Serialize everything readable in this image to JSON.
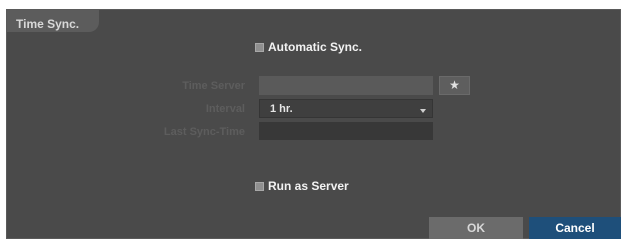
{
  "dialog": {
    "title": "Time Sync."
  },
  "automatic_sync": {
    "label": "Automatic Sync."
  },
  "fields": {
    "time_server_label": "Time Server",
    "time_server_value": "",
    "interval_label": "Interval",
    "interval_value": "1 hr.",
    "last_sync_label": "Last Sync-Time",
    "last_sync_value": ""
  },
  "run_as_server": {
    "label": "Run as Server"
  },
  "buttons": {
    "ok": "OK",
    "cancel": "Cancel"
  },
  "icons": {
    "search_button": "star-icon"
  },
  "colors": {
    "accent": "#1e4f7a",
    "panel": "#4a4a4a"
  }
}
